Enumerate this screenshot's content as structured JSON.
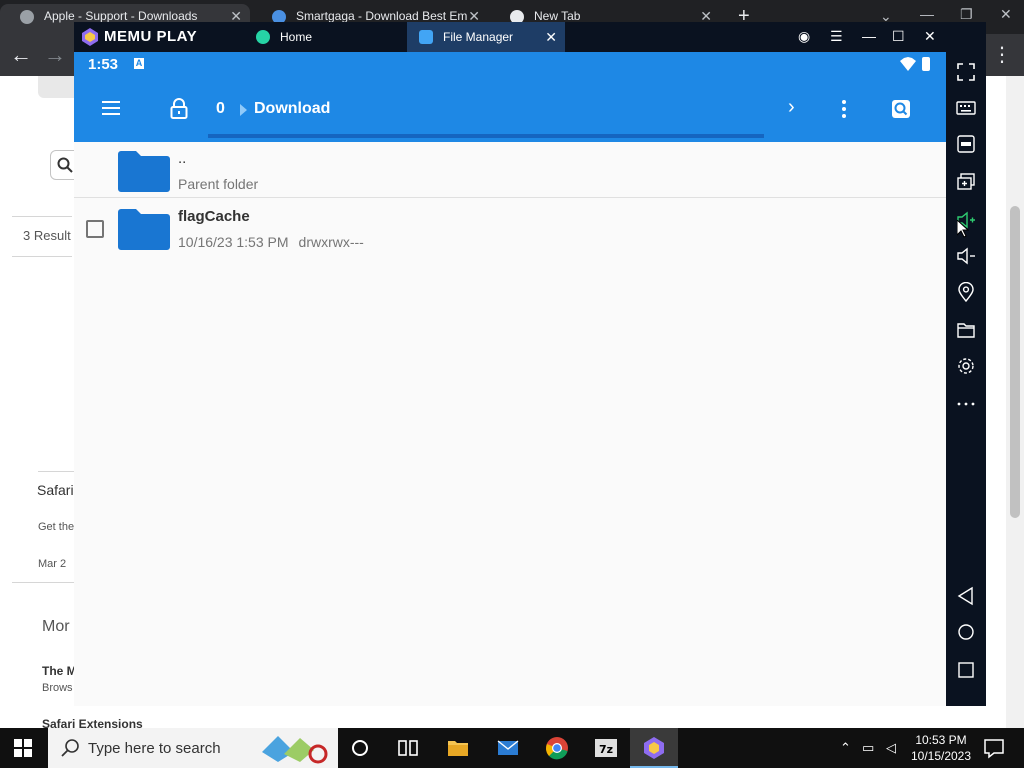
{
  "chrome": {
    "tabs": [
      {
        "label": "Apple - Support - Downloads",
        "active": true
      },
      {
        "label": "Smartgaga - Download Best Em",
        "active": false
      },
      {
        "label": "New Tab",
        "active": false
      }
    ],
    "page": {
      "results_label": "3 Result",
      "safari_heading": "Safari",
      "safari_desc": "Get the",
      "safari_date": "Mar 2",
      "more_heading": "Mor",
      "the_m": "The M",
      "brows": "Brows",
      "safari_extensions": "Safari Extensions"
    }
  },
  "memu": {
    "brand": "MEMU PLAY",
    "tabs": [
      {
        "label": "Home"
      },
      {
        "label": "File Manager"
      }
    ]
  },
  "android": {
    "status_time": "1:53",
    "status_a": "A",
    "breadcrumb": {
      "root": "0",
      "current": "Download"
    },
    "rows": [
      {
        "name": "..",
        "subtitle": "Parent folder"
      },
      {
        "name": "flagCache",
        "date": "10/16/23 1:53 PM",
        "perms": "drwxrwx---"
      }
    ]
  },
  "taskbar": {
    "search_placeholder": "Type here to search",
    "time": "10:53 PM",
    "date": "10/15/2023"
  },
  "colors": {
    "android_blue": "#1e88e5",
    "folder_blue": "#1976d2",
    "memu_dark": "#0a1220"
  }
}
